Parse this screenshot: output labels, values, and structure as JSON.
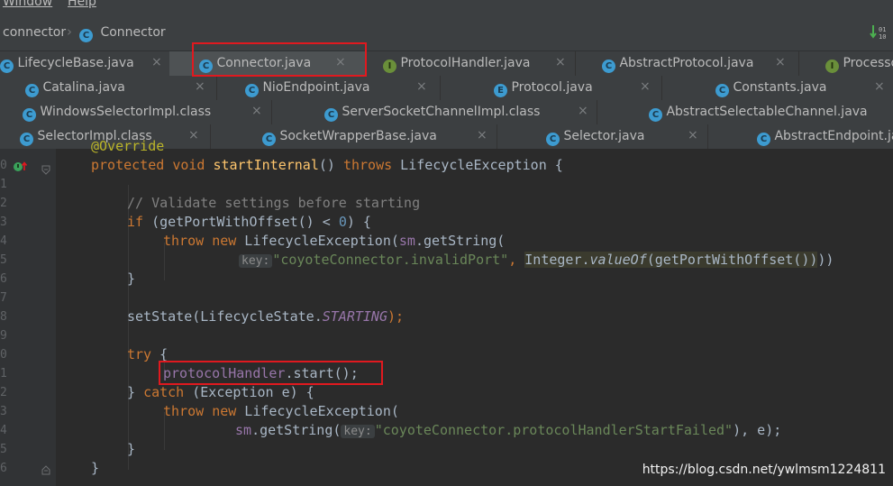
{
  "menu": {
    "window": "Window",
    "help": "Help"
  },
  "breadcrumb": {
    "package": "connector",
    "class": "Connector",
    "class_icon": "C"
  },
  "tabs": {
    "row1": [
      {
        "label": "LifecycleBase.java",
        "icon": "C"
      },
      {
        "label": "Connector.java",
        "icon": "C"
      },
      {
        "label": "ProtocolHandler.java",
        "icon": "I"
      },
      {
        "label": "AbstractProtocol.java",
        "icon": "C"
      },
      {
        "label": "Processo",
        "icon": "I"
      }
    ],
    "row2": [
      {
        "label": "Catalina.java",
        "icon": "C"
      },
      {
        "label": "NioEndpoint.java",
        "icon": "C"
      },
      {
        "label": "Protocol.java",
        "icon": "E"
      },
      {
        "label": "Constants.java",
        "icon": "C"
      }
    ],
    "row3": [
      {
        "label": "WindowsSelectorImpl.class",
        "icon": "C"
      },
      {
        "label": "ServerSocketChannelImpl.class",
        "icon": "C"
      },
      {
        "label": "AbstractSelectableChannel.java",
        "icon": "C"
      }
    ],
    "row4": [
      {
        "label": "SelectorImpl.class",
        "icon": "C"
      },
      {
        "label": "SocketWrapperBase.java",
        "icon": "C"
      },
      {
        "label": "Selector.java",
        "icon": "C"
      },
      {
        "label": "AbstractEndpoint.ja",
        "icon": "C"
      }
    ],
    "close_glyph": "×"
  },
  "gutter": {
    "lines": [
      "0",
      "1",
      "2",
      "3",
      "4",
      "5",
      "6",
      "7",
      "8",
      "9",
      "0",
      "1",
      "2",
      "3",
      "4",
      "5",
      "6"
    ]
  },
  "code": {
    "l0_override": "@Override",
    "l1": {
      "kw1": "protected",
      "kw2": "void",
      "fn": "startInternal",
      "paren": "()",
      "kw3": "throws",
      "rest": " LifecycleException {"
    },
    "l3_comment": "// Validate settings before starting",
    "l4": {
      "kw": "if",
      "a": " (getPortWithOffset() < ",
      "num": "0",
      "b": ") {"
    },
    "l5": {
      "kw1": "throw",
      "kw2": "new",
      "a": " LifecycleException(",
      "fld": "sm",
      "b": ".getString("
    },
    "l6": {
      "hint": "key:",
      "str": "\"coyoteConnector.invalidPort\"",
      "comma": ", ",
      "hl_a": "Integer.",
      "hl_fn": "valueOf",
      "hl_b": "(getPortWithOffset())",
      ")": "))"
    },
    "l7": "}",
    "l9": {
      "a": "setState(LifecycleState.",
      "const": "STARTING",
      "b": ");"
    },
    "l11": {
      "kw": "try",
      "b": " {"
    },
    "l12": {
      "fld": "protocolHandler",
      "b": ".start();"
    },
    "l13": {
      "a": "} ",
      "kw": "catch",
      "b": " (Exception e) {"
    },
    "l14": {
      "kw1": "throw",
      "kw2": "new",
      "a": " LifecycleException("
    },
    "l15": {
      "fld": "sm",
      "a": ".getString(",
      "hint": "key:",
      "str": "\"coyoteConnector.protocolHandlerStartFailed\"",
      "b": "), e);"
    },
    "l16": "}",
    "l17": "}"
  },
  "toolbar_right_icon": "sort-icon",
  "watermark": "https://blog.csdn.net/ywlmsm1224811",
  "colors": {
    "keyword": "#cc7832",
    "string": "#6a8759",
    "comment": "#808080",
    "field": "#9876aa",
    "method": "#ffc66d",
    "annotation_box": "#e0191f"
  }
}
